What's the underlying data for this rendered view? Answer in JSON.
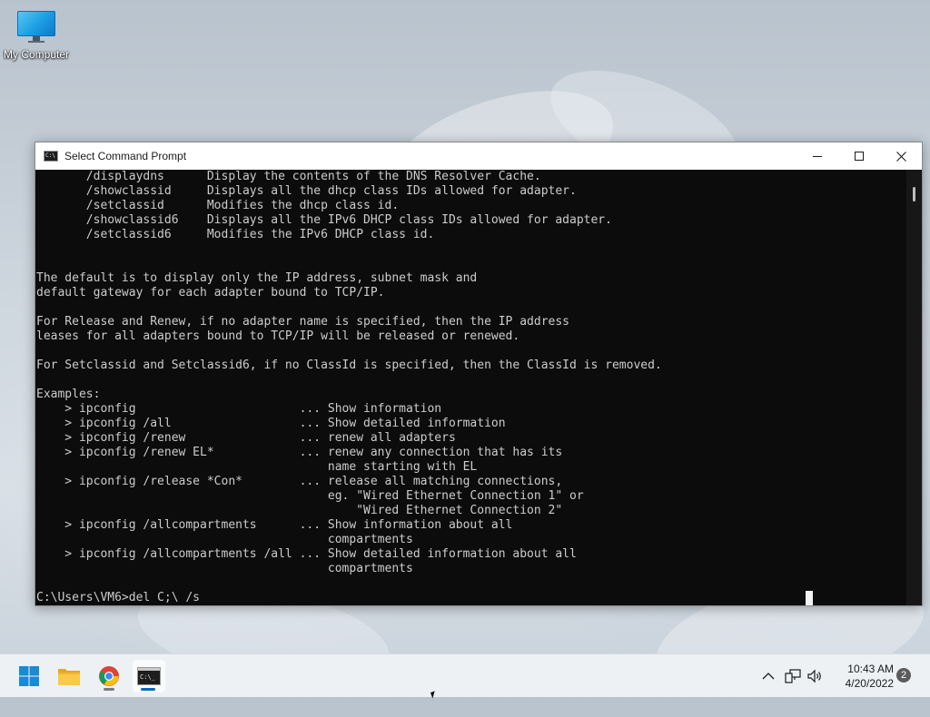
{
  "desktop": {
    "icons": [
      {
        "label": "My Computer",
        "icon": "computer-monitor-icon"
      }
    ]
  },
  "window": {
    "title": "Select Command Prompt",
    "icon": "command-prompt-icon",
    "controls": {
      "minimize": "minimize-icon",
      "maximize": "maximize-icon",
      "close": "close-icon"
    }
  },
  "console": {
    "lines": [
      "       /displaydns      Display the contents of the DNS Resolver Cache.",
      "       /showclassid     Displays all the dhcp class IDs allowed for adapter.",
      "       /setclassid      Modifies the dhcp class id.",
      "       /showclassid6    Displays all the IPv6 DHCP class IDs allowed for adapter.",
      "       /setclassid6     Modifies the IPv6 DHCP class id.",
      "",
      "",
      "The default is to display only the IP address, subnet mask and",
      "default gateway for each adapter bound to TCP/IP.",
      "",
      "For Release and Renew, if no adapter name is specified, then the IP address",
      "leases for all adapters bound to TCP/IP will be released or renewed.",
      "",
      "For Setclassid and Setclassid6, if no ClassId is specified, then the ClassId is removed.",
      "",
      "Examples:",
      "    > ipconfig                       ... Show information",
      "    > ipconfig /all                  ... Show detailed information",
      "    > ipconfig /renew                ... renew all adapters",
      "    > ipconfig /renew EL*            ... renew any connection that has its",
      "                                         name starting with EL",
      "    > ipconfig /release *Con*        ... release all matching connections,",
      "                                         eg. \"Wired Ethernet Connection 1\" or",
      "                                             \"Wired Ethernet Connection 2\"",
      "    > ipconfig /allcompartments      ... Show information about all",
      "                                         compartments",
      "    > ipconfig /allcompartments /all ... Show detailed information about all",
      "                                         compartments",
      "",
      "C:\\Users\\VM6>del C;\\ /s"
    ]
  },
  "taskbar": {
    "apps": [
      {
        "name": "Start",
        "icon": "windows-start-icon",
        "running": false
      },
      {
        "name": "File Explorer",
        "icon": "folder-icon",
        "running": false
      },
      {
        "name": "Google Chrome",
        "icon": "chrome-icon",
        "running": true
      },
      {
        "name": "Command Prompt",
        "icon": "command-prompt-icon",
        "running": true,
        "active": true
      }
    ],
    "tray": {
      "overflow_icon": "chevron-up-icon",
      "network_icon": "network-icon",
      "volume_icon": "speaker-icon",
      "time": "10:43 AM",
      "date": "4/20/2022",
      "notification_count": "2"
    }
  },
  "colors": {
    "console_bg": "#0c0c0c",
    "console_text": "#cccccc",
    "accent": "#0067c0"
  }
}
